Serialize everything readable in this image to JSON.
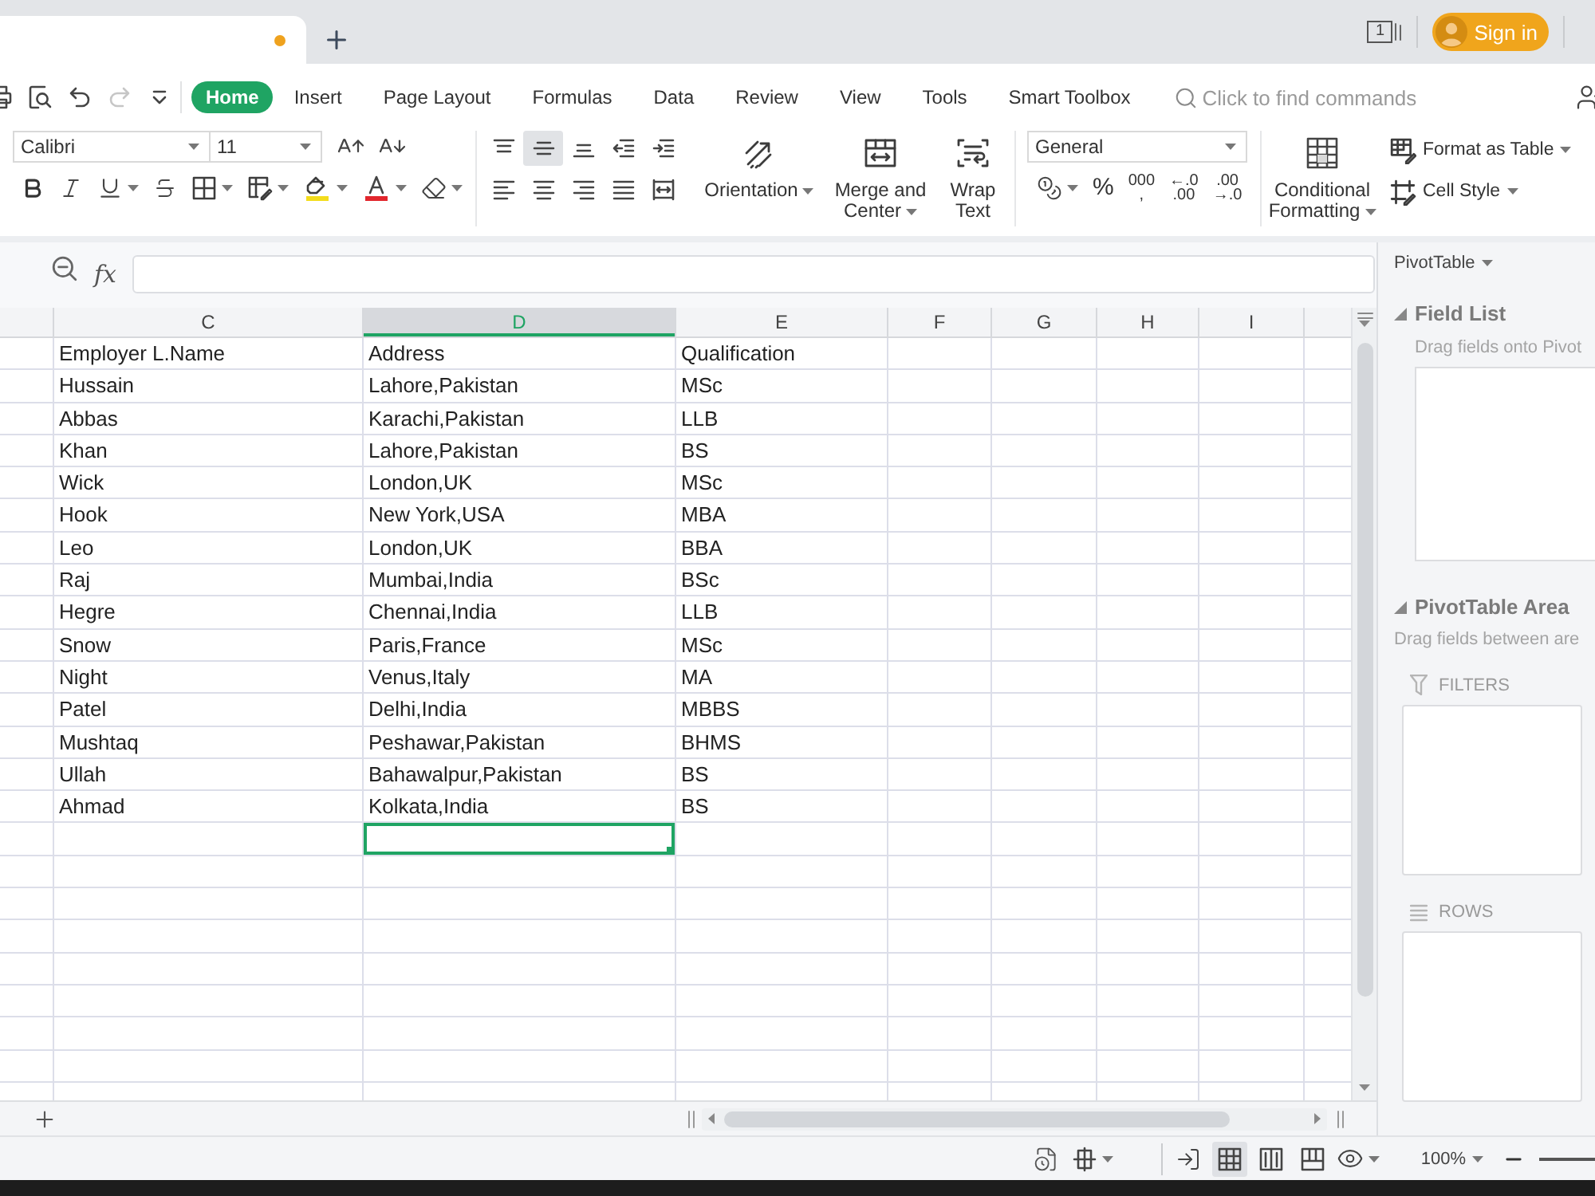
{
  "title_bar": {
    "document_tab": {
      "unsaved": true
    },
    "window_count": "1",
    "sign_in": "Sign in"
  },
  "quick_access": [
    {
      "kind": "print",
      "disabled": false
    },
    {
      "kind": "preview",
      "disabled": false
    },
    {
      "kind": "undo",
      "disabled": false
    },
    {
      "kind": "redo",
      "disabled": true
    },
    {
      "kind": "customize",
      "disabled": false
    }
  ],
  "ribbon_tabs": [
    {
      "label": "Home",
      "selected": true
    },
    {
      "label": "Insert",
      "selected": false
    },
    {
      "label": "Page Layout",
      "selected": false
    },
    {
      "label": "Formulas",
      "selected": false
    },
    {
      "label": "Data",
      "selected": false
    },
    {
      "label": "Review",
      "selected": false
    },
    {
      "label": "View",
      "selected": false
    },
    {
      "label": "Tools",
      "selected": false
    },
    {
      "label": "Smart Toolbox",
      "selected": false
    }
  ],
  "command_search": {
    "placeholder": "Click to find commands"
  },
  "font": {
    "name": "Calibri",
    "size": "11"
  },
  "alignment": [
    {
      "kind": "top",
      "selected": false
    },
    {
      "kind": "middle",
      "selected": true
    },
    {
      "kind": "bottom",
      "selected": false
    }
  ],
  "large_buttons": [
    {
      "kind": "orientation",
      "label": "Orientation",
      "menu": true
    },
    {
      "kind": "merge",
      "label": "Merge and Center",
      "menu": true
    },
    {
      "kind": "wrap",
      "label": "Wrap Text",
      "menu": false
    }
  ],
  "number_format": {
    "value": "General"
  },
  "number_buttons": [
    {
      "kind": "accounting",
      "menu": true
    },
    {
      "kind": "percent",
      "lines": [
        "%"
      ]
    },
    {
      "kind": "thousands",
      "lines": [
        "000",
        ","
      ]
    },
    {
      "kind": "add_decimal",
      "lines": [
        "←.0",
        ".00"
      ]
    },
    {
      "kind": "remove_decimal",
      "lines": [
        ".00",
        "→.0"
      ]
    }
  ],
  "conditional_formatting": {
    "label": "Conditional Formatting",
    "menu": true
  },
  "style_buttons": [
    {
      "kind": "table",
      "label": "Format as Table",
      "menu": true
    },
    {
      "kind": "cell",
      "label": "Cell Style",
      "menu": true
    }
  ],
  "formula_bar": {
    "function_label": "fx"
  },
  "sheet": {
    "columns": [
      {
        "label": "C",
        "selected": false
      },
      {
        "label": "D",
        "selected": true
      },
      {
        "label": "E",
        "selected": false
      },
      {
        "label": "F",
        "selected": false
      },
      {
        "label": "G",
        "selected": false
      },
      {
        "label": "H",
        "selected": false
      },
      {
        "label": "I",
        "selected": false
      }
    ],
    "rows": [
      {
        "cells": [
          {
            "text": "Employer L.Name",
            "selected": false
          },
          {
            "text": "Address",
            "selected": false
          },
          {
            "text": "Qualification",
            "selected": false
          }
        ]
      },
      {
        "cells": [
          {
            "text": "Hussain",
            "selected": false
          },
          {
            "text": "Lahore,Pakistan",
            "selected": false
          },
          {
            "text": "MSc",
            "selected": false
          }
        ]
      },
      {
        "cells": [
          {
            "text": "Abbas",
            "selected": false
          },
          {
            "text": "Karachi,Pakistan",
            "selected": false
          },
          {
            "text": "LLB",
            "selected": false
          }
        ]
      },
      {
        "cells": [
          {
            "text": "Khan",
            "selected": false
          },
          {
            "text": "Lahore,Pakistan",
            "selected": false
          },
          {
            "text": "BS",
            "selected": false
          }
        ]
      },
      {
        "cells": [
          {
            "text": "Wick",
            "selected": false
          },
          {
            "text": "London,UK",
            "selected": false
          },
          {
            "text": "MSc",
            "selected": false
          }
        ]
      },
      {
        "cells": [
          {
            "text": "Hook",
            "selected": false
          },
          {
            "text": "New York,USA",
            "selected": false
          },
          {
            "text": "MBA",
            "selected": false
          }
        ]
      },
      {
        "cells": [
          {
            "text": "Leo",
            "selected": false
          },
          {
            "text": "London,UK",
            "selected": false
          },
          {
            "text": "BBA",
            "selected": false
          }
        ]
      },
      {
        "cells": [
          {
            "text": "Raj",
            "selected": false
          },
          {
            "text": "Mumbai,India",
            "selected": false
          },
          {
            "text": "BSc",
            "selected": false
          }
        ]
      },
      {
        "cells": [
          {
            "text": "Hegre",
            "selected": false
          },
          {
            "text": "Chennai,India",
            "selected": false
          },
          {
            "text": "LLB",
            "selected": false
          }
        ]
      },
      {
        "cells": [
          {
            "text": "Snow",
            "selected": false
          },
          {
            "text": "Paris,France",
            "selected": false
          },
          {
            "text": "MSc",
            "selected": false
          }
        ]
      },
      {
        "cells": [
          {
            "text": "Night",
            "selected": false
          },
          {
            "text": "Venus,Italy",
            "selected": false
          },
          {
            "text": "MA",
            "selected": false
          }
        ]
      },
      {
        "cells": [
          {
            "text": "Patel",
            "selected": false
          },
          {
            "text": "Delhi,India",
            "selected": false
          },
          {
            "text": "MBBS",
            "selected": false
          }
        ]
      },
      {
        "cells": [
          {
            "text": "Mushtaq",
            "selected": false
          },
          {
            "text": "Peshawar,Pakistan",
            "selected": false
          },
          {
            "text": "BHMS",
            "selected": false
          }
        ]
      },
      {
        "cells": [
          {
            "text": "Ullah",
            "selected": false
          },
          {
            "text": "Bahawalpur,Pakistan",
            "selected": false
          },
          {
            "text": "BS",
            "selected": false
          }
        ]
      },
      {
        "cells": [
          {
            "text": "Ahmad",
            "selected": false
          },
          {
            "text": "Kolkata,India",
            "selected": false
          },
          {
            "text": "BS",
            "selected": false
          }
        ]
      },
      {
        "cells": [
          {
            "selected": false
          },
          {
            "selected": true
          },
          {
            "selected": false
          }
        ]
      }
    ]
  },
  "status_bar": {
    "views": [
      {
        "kind": "reading",
        "selected": false
      },
      {
        "kind": "normal",
        "selected": true
      },
      {
        "kind": "page",
        "selected": false
      },
      {
        "kind": "page_break",
        "selected": false
      }
    ],
    "zoom": "100%"
  },
  "pivot_panel": {
    "title": "PivotTable",
    "field_list": {
      "heading": "Field List",
      "expanded": true,
      "hint": "Drag fields onto Pivot"
    },
    "areas": {
      "heading": "PivotTable Area",
      "expanded": true,
      "hint": "Drag fields between are",
      "zones": [
        {
          "kind": "filters",
          "label": "FILTERS"
        },
        {
          "kind": "rows",
          "label": "ROWS"
        }
      ]
    }
  }
}
